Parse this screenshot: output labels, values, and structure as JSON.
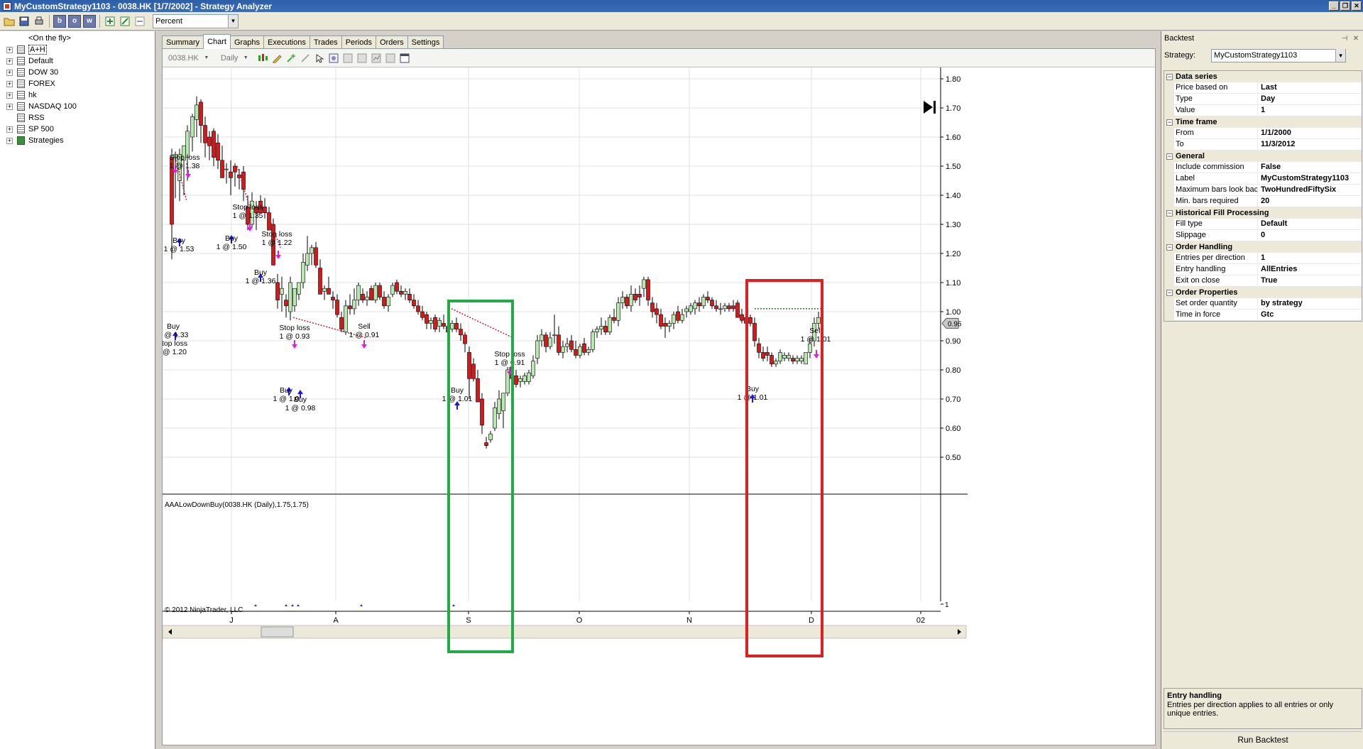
{
  "window": {
    "title": "MyCustomStrategy1103 - 0038.HK [1/7/2002] - Strategy Analyzer",
    "controls": {
      "minimize": "_",
      "restore": "❐",
      "close": "✕"
    }
  },
  "toolbar": {
    "box_buttons": [
      "b",
      "o",
      "w"
    ],
    "display_select": "Percent"
  },
  "tree": {
    "items": [
      {
        "label": "<On the fly>",
        "expandable": false,
        "icon": "none"
      },
      {
        "label": "A+H",
        "expandable": true,
        "icon": "list",
        "selected": true
      },
      {
        "label": "Default",
        "expandable": true,
        "icon": "list"
      },
      {
        "label": "DOW 30",
        "expandable": true,
        "icon": "list"
      },
      {
        "label": "FOREX",
        "expandable": true,
        "icon": "list"
      },
      {
        "label": "hk",
        "expandable": true,
        "icon": "list"
      },
      {
        "label": "NASDAQ 100",
        "expandable": true,
        "icon": "list"
      },
      {
        "label": "RSS",
        "expandable": false,
        "icon": "list"
      },
      {
        "label": "SP 500",
        "expandable": true,
        "icon": "list"
      },
      {
        "label": "Strategies",
        "expandable": true,
        "icon": "strategy"
      }
    ]
  },
  "tabs": [
    "Summary",
    "Chart",
    "Graphs",
    "Executions",
    "Trades",
    "Periods",
    "Orders",
    "Settings"
  ],
  "active_tab": "Chart",
  "chart_toolbar": {
    "instrument": "0038.HK",
    "period": "Daily"
  },
  "chart": {
    "price_axis": [
      "1.80",
      "1.70",
      "1.60",
      "1.50",
      "1.40",
      "1.30",
      "1.20",
      "1.10",
      "1.00",
      "0.90",
      "0.80",
      "0.70",
      "0.60",
      "0.50"
    ],
    "current_price_label": "0.96",
    "indicator_label": "AAALowDownBuy(0038.HK (Daily),1.75,1.75)",
    "indicator_axis_label": "1",
    "copyright": "© 2012 NinjaTrader, LLC",
    "time_axis": [
      "J",
      "A",
      "S",
      "O",
      "N",
      "D",
      "02"
    ],
    "colors": {
      "up": "#b8e8b0",
      "down": "#d81818",
      "buy_arrow": "#1818e0",
      "sell_arrow": "#e818e8",
      "green_box": "#22aa44",
      "red_box": "#e02020"
    },
    "annotations": [
      "Stop loss",
      "1 @ 1.38",
      "Buy",
      "1 @ 1.53",
      "Stop loss",
      "1 @ 1.35",
      "Buy",
      "1 @ 1.50",
      "Stop loss",
      "1 @ 1.22",
      "Buy",
      "1 @ 1.36",
      "Buy",
      "1 @ 1.33",
      "top loss",
      "@ 1.20",
      "Stop loss",
      "1 @ 0.93",
      "Buy",
      "1 @ 1.0",
      "Buy",
      "1 @ 0.98",
      "Sell",
      "1 @ 0.91",
      "Stop loss",
      "1 @ 0.91",
      "Buy",
      "1 @ 1.01",
      "Sell",
      "1 @ 1.01",
      "Buy",
      "1 @ 1.01"
    ]
  },
  "right_panel": {
    "title": "Backtest",
    "pin_icon": "⊣",
    "close_icon": "✕",
    "strategy_label": "Strategy:",
    "strategy_value": "MyCustomStrategy1103",
    "categories": [
      {
        "name": "Data series",
        "rows": [
          {
            "name": "Price based on",
            "value": "Last"
          },
          {
            "name": "Type",
            "value": "Day"
          },
          {
            "name": "Value",
            "value": "1"
          }
        ]
      },
      {
        "name": "Time frame",
        "rows": [
          {
            "name": "From",
            "value": "1/1/2000"
          },
          {
            "name": "To",
            "value": "11/3/2012"
          }
        ]
      },
      {
        "name": "General",
        "rows": [
          {
            "name": "Include commission",
            "value": "False"
          },
          {
            "name": "Label",
            "value": "MyCustomStrategy1103"
          },
          {
            "name": "Maximum bars look bac",
            "value": "TwoHundredFiftySix"
          },
          {
            "name": "Min. bars required",
            "value": "20"
          }
        ]
      },
      {
        "name": "Historical Fill Processing",
        "rows": [
          {
            "name": "Fill type",
            "value": "Default"
          },
          {
            "name": "Slippage",
            "value": "0"
          }
        ]
      },
      {
        "name": "Order Handling",
        "rows": [
          {
            "name": "Entries per direction",
            "value": "1"
          },
          {
            "name": "Entry handling",
            "value": "AllEntries"
          },
          {
            "name": "Exit on close",
            "value": "True"
          }
        ]
      },
      {
        "name": "Order Properties",
        "rows": [
          {
            "name": "Set order quantity",
            "value": "by strategy"
          },
          {
            "name": "Time in force",
            "value": "Gtc"
          }
        ]
      }
    ],
    "help_title": "Entry handling",
    "help_text": "Entries per direction applies to all entries or only unique entries.",
    "run_button": "Run Backtest"
  }
}
